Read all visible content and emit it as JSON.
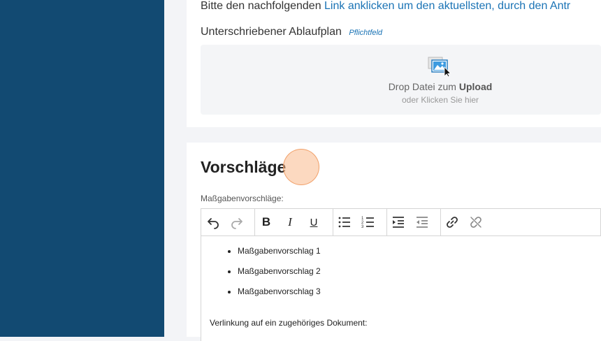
{
  "upload_section": {
    "intro_prefix": "Bitte den nachfolgenden ",
    "intro_link": "Link anklicken um den aktuellsten, durch den Antr",
    "field_label": "Unterschriebener Ablaufplan",
    "required_badge": "Pflichtfeld",
    "drop_prefix": "Drop Datei zum ",
    "drop_bold": "Upload",
    "drop_sub": "oder Klicken Sie hier",
    "icon": "image-upload-icon"
  },
  "proposals_section": {
    "title": "Vorschläge",
    "editor_label": "Maßgabenvorschläge:",
    "toolbar": {
      "undo": "undo-icon",
      "redo": "redo-icon",
      "bold": "B",
      "italic": "I",
      "underline": "U",
      "bullet_list": "bullet-list-icon",
      "numbered_list": "numbered-list-icon",
      "indent": "indent-icon",
      "outdent": "outdent-icon",
      "link": "link-icon",
      "unlink": "unlink-icon"
    },
    "list_items": [
      "Maßgabenvorschlag 1",
      "Maßgabenvorschlag 2",
      "Maßgabenvorschlag 3"
    ],
    "paragraph": "Verlinkung auf ein zugehöriges Dokument:"
  },
  "colors": {
    "sidebar": "#124a72",
    "link": "#1a73b5",
    "background": "#f3f4f7"
  }
}
